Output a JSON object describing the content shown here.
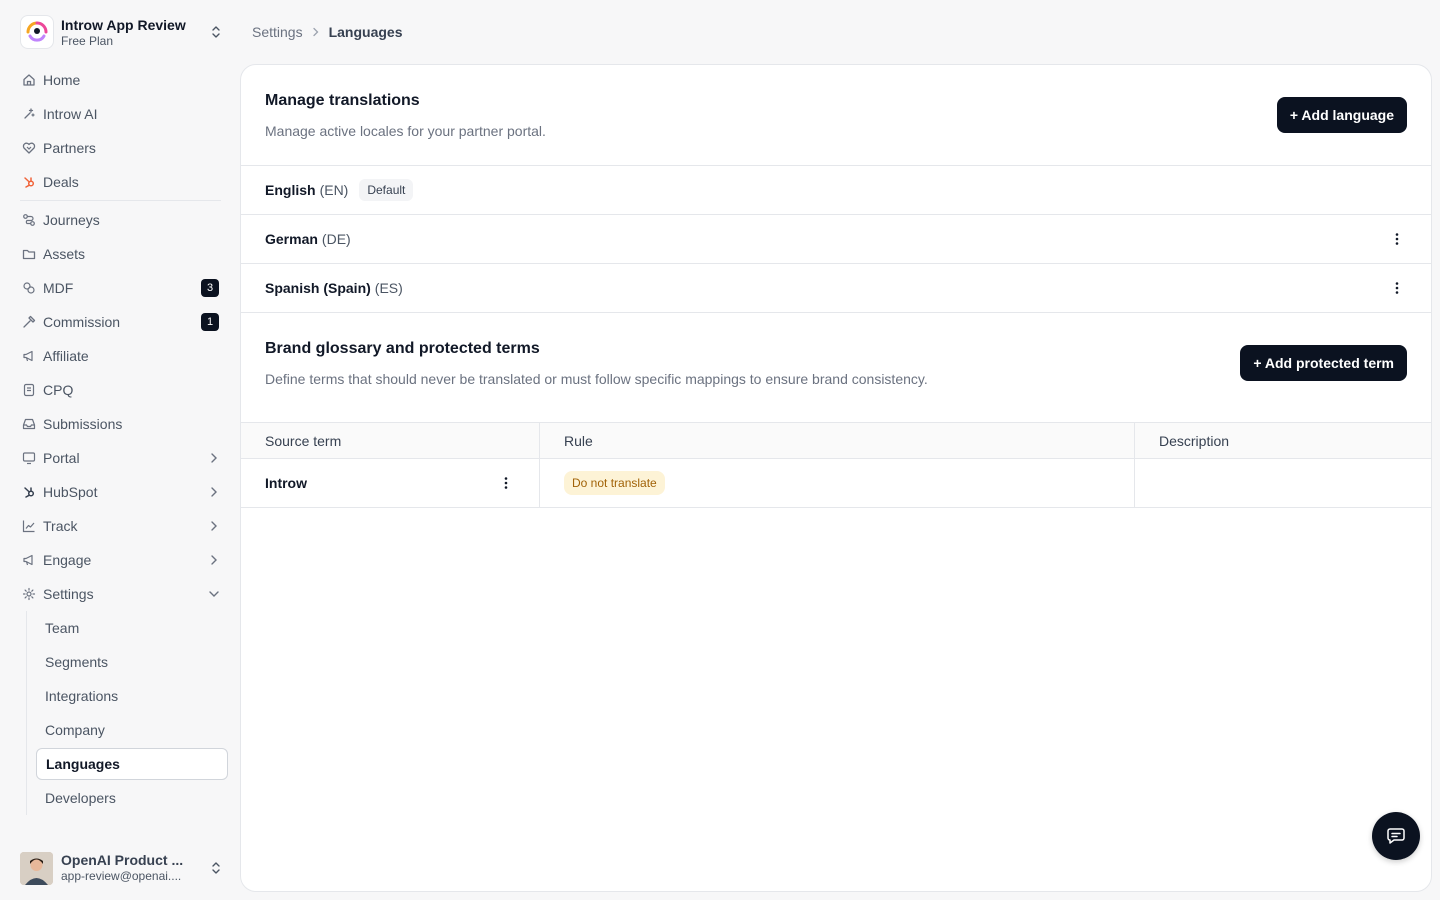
{
  "workspace": {
    "name": "Introw App Review",
    "plan": "Free Plan"
  },
  "nav": {
    "primary": [
      {
        "id": "home",
        "label": "Home",
        "icon": "home-icon"
      },
      {
        "id": "introw-ai",
        "label": "Introw AI",
        "icon": "sparkle-icon"
      },
      {
        "id": "partners",
        "label": "Partners",
        "icon": "handshake-icon"
      },
      {
        "id": "deals",
        "label": "Deals",
        "icon": "hubspot-icon"
      }
    ],
    "secondary": [
      {
        "id": "journeys",
        "label": "Journeys",
        "icon": "route-icon"
      },
      {
        "id": "assets",
        "label": "Assets",
        "icon": "folder-icon"
      },
      {
        "id": "mdf",
        "label": "MDF",
        "icon": "coins-icon",
        "badge": "3"
      },
      {
        "id": "commission",
        "label": "Commission",
        "icon": "hammer-icon",
        "badge": "1"
      },
      {
        "id": "affiliate",
        "label": "Affiliate",
        "icon": "megaphone-icon"
      },
      {
        "id": "cpq",
        "label": "CPQ",
        "icon": "receipt-icon"
      },
      {
        "id": "submissions",
        "label": "Submissions",
        "icon": "inbox-icon"
      },
      {
        "id": "portal",
        "label": "Portal",
        "icon": "monitor-icon"
      },
      {
        "id": "hubspot",
        "label": "HubSpot",
        "icon": "hubspot-icon"
      },
      {
        "id": "track",
        "label": "Track",
        "icon": "chart-line-icon"
      },
      {
        "id": "engage",
        "label": "Engage",
        "icon": "megaphone-icon"
      },
      {
        "id": "settings",
        "label": "Settings",
        "icon": "gear-icon"
      }
    ],
    "settings_sub": [
      {
        "id": "team",
        "label": "Team"
      },
      {
        "id": "segments",
        "label": "Segments"
      },
      {
        "id": "integrations",
        "label": "Integrations"
      },
      {
        "id": "company",
        "label": "Company"
      },
      {
        "id": "languages",
        "label": "Languages"
      },
      {
        "id": "developers",
        "label": "Developers"
      }
    ]
  },
  "user": {
    "name": "OpenAI Product ...",
    "email": "app-review@openai...."
  },
  "breadcrumb": {
    "parent": "Settings",
    "current": "Languages"
  },
  "translations": {
    "title": "Manage translations",
    "description": "Manage active locales for your partner portal.",
    "add_label": "+ Add language",
    "languages": [
      {
        "name": "English",
        "code": "(EN)",
        "badge": "Default"
      },
      {
        "name": "German",
        "code": "(DE)"
      },
      {
        "name": "Spanish (Spain)",
        "code": "(ES)"
      }
    ]
  },
  "glossary": {
    "title": "Brand glossary and protected terms",
    "description": "Define terms that should never be translated or must follow specific mappings to ensure brand consistency.",
    "add_label": "+ Add protected term",
    "columns": {
      "source": "Source term",
      "rule": "Rule",
      "description": "Description"
    },
    "rows": [
      {
        "source": "Introw",
        "rule": "Do not translate",
        "description": ""
      }
    ]
  },
  "colors": {
    "primary_dark": "#0b1220",
    "rule_badge_bg": "#fdf3d6",
    "rule_badge_text": "#a16207",
    "hubspot_orange": "#f0643a"
  }
}
